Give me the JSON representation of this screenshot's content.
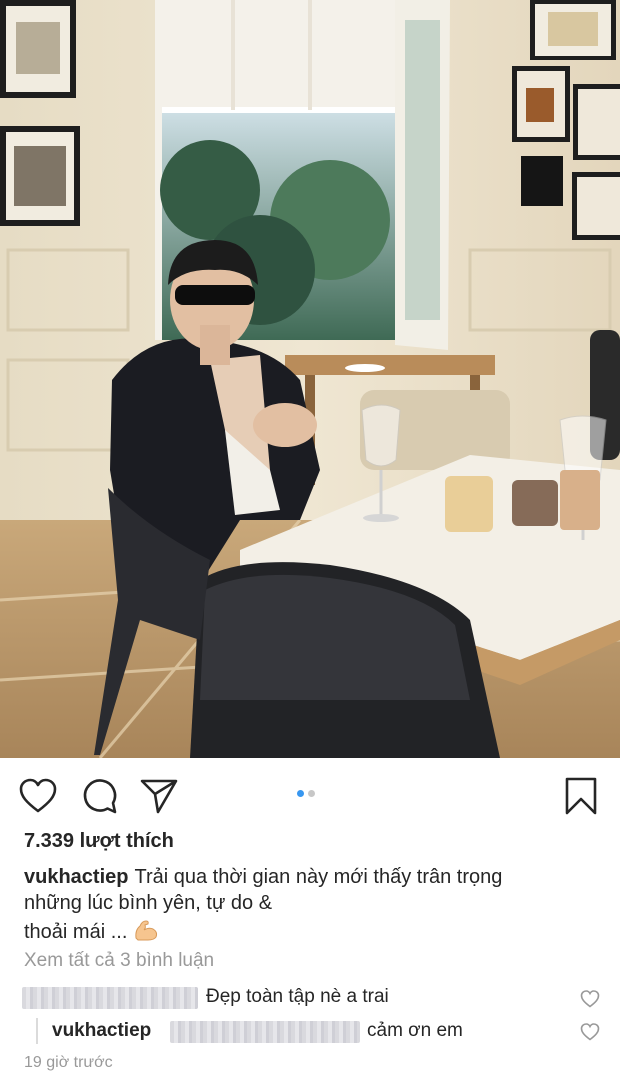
{
  "post": {
    "likes_text": "7.339 lượt thích",
    "caption": {
      "username": "vukhactiep",
      "line1": "Trải qua thời gian này mới thấy trân trọng",
      "line2": "những lúc bình yên, tự do &",
      "line3": "thoải mái ..."
    },
    "caption_emoji": "flexed-biceps-emoji",
    "view_all_comments": "Xem tất cả 3 bình luận",
    "comments": [
      {
        "username": "",
        "text": "Đẹp toàn tập nè a trai"
      },
      {
        "username": "vukhactiep",
        "text_prefix": "@",
        "text": "cảm ơn em"
      }
    ],
    "timestamp": "19 giờ trước"
  },
  "carousel": {
    "count": 2,
    "active_index": 0
  },
  "icons": {
    "like": "heart-icon",
    "comment": "comment-bubble-icon",
    "share": "paper-plane-icon",
    "save": "bookmark-icon"
  },
  "colors": {
    "accent": "#3897f0",
    "text": "#262626",
    "muted": "#999999",
    "dot_inactive": "#c7c7c7"
  }
}
